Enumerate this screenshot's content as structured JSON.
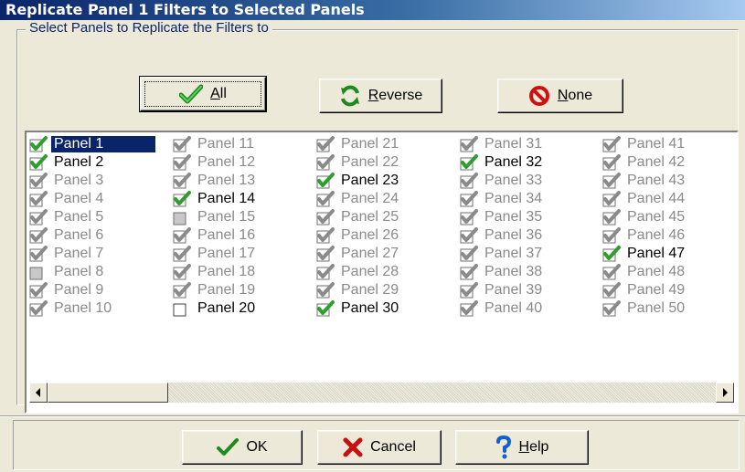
{
  "window": {
    "title": "Replicate Panel 1 Filters to Selected Panels"
  },
  "group": {
    "legend": "Select Panels to Replicate the Filters to"
  },
  "buttons": {
    "all": {
      "mnemonic": "A",
      "rest": "ll",
      "icon": "green-check-icon"
    },
    "reverse": {
      "mnemonic": "R",
      "rest": "everse",
      "icon": "green-refresh-icon"
    },
    "none": {
      "mnemonic": "N",
      "rest": "one",
      "icon": "red-no-sign-icon"
    },
    "ok": {
      "label": "OK",
      "icon": "green-check-icon"
    },
    "cancel": {
      "label": "Cancel",
      "icon": "red-x-icon"
    },
    "help": {
      "mnemonic": "H",
      "rest": "elp",
      "icon": "blue-question-icon"
    }
  },
  "panels": [
    {
      "label": "Panel 1",
      "state": "checked",
      "enabled": true,
      "selected": true
    },
    {
      "label": "Panel 2",
      "state": "checked",
      "enabled": true
    },
    {
      "label": "Panel 3",
      "state": "checked",
      "enabled": false
    },
    {
      "label": "Panel 4",
      "state": "checked",
      "enabled": false
    },
    {
      "label": "Panel 5",
      "state": "checked",
      "enabled": false
    },
    {
      "label": "Panel 6",
      "state": "checked",
      "enabled": false
    },
    {
      "label": "Panel 7",
      "state": "checked",
      "enabled": false
    },
    {
      "label": "Panel 8",
      "state": "grayed",
      "enabled": false
    },
    {
      "label": "Panel 9",
      "state": "checked",
      "enabled": false
    },
    {
      "label": "Panel 10",
      "state": "checked",
      "enabled": false
    },
    {
      "label": "Panel 11",
      "state": "checked",
      "enabled": false
    },
    {
      "label": "Panel 12",
      "state": "checked",
      "enabled": false
    },
    {
      "label": "Panel 13",
      "state": "checked",
      "enabled": false
    },
    {
      "label": "Panel 14",
      "state": "checked",
      "enabled": true
    },
    {
      "label": "Panel 15",
      "state": "grayed",
      "enabled": false
    },
    {
      "label": "Panel 16",
      "state": "checked",
      "enabled": false
    },
    {
      "label": "Panel 17",
      "state": "checked",
      "enabled": false
    },
    {
      "label": "Panel 18",
      "state": "checked",
      "enabled": false
    },
    {
      "label": "Panel 19",
      "state": "checked",
      "enabled": false
    },
    {
      "label": "Panel 20",
      "state": "unchecked",
      "enabled": true
    },
    {
      "label": "Panel 21",
      "state": "checked",
      "enabled": false
    },
    {
      "label": "Panel 22",
      "state": "checked",
      "enabled": false
    },
    {
      "label": "Panel 23",
      "state": "checked",
      "enabled": true
    },
    {
      "label": "Panel 24",
      "state": "checked",
      "enabled": false
    },
    {
      "label": "Panel 25",
      "state": "checked",
      "enabled": false
    },
    {
      "label": "Panel 26",
      "state": "checked",
      "enabled": false
    },
    {
      "label": "Panel 27",
      "state": "checked",
      "enabled": false
    },
    {
      "label": "Panel 28",
      "state": "checked",
      "enabled": false
    },
    {
      "label": "Panel 29",
      "state": "checked",
      "enabled": false
    },
    {
      "label": "Panel 30",
      "state": "checked",
      "enabled": true
    },
    {
      "label": "Panel 31",
      "state": "checked",
      "enabled": false
    },
    {
      "label": "Panel 32",
      "state": "checked",
      "enabled": true
    },
    {
      "label": "Panel 33",
      "state": "checked",
      "enabled": false
    },
    {
      "label": "Panel 34",
      "state": "checked",
      "enabled": false
    },
    {
      "label": "Panel 35",
      "state": "checked",
      "enabled": false
    },
    {
      "label": "Panel 36",
      "state": "checked",
      "enabled": false
    },
    {
      "label": "Panel 37",
      "state": "checked",
      "enabled": false
    },
    {
      "label": "Panel 38",
      "state": "checked",
      "enabled": false
    },
    {
      "label": "Panel 39",
      "state": "checked",
      "enabled": false
    },
    {
      "label": "Panel 40",
      "state": "checked",
      "enabled": false
    },
    {
      "label": "Panel 41",
      "state": "checked",
      "enabled": false
    },
    {
      "label": "Panel 42",
      "state": "checked",
      "enabled": false
    },
    {
      "label": "Panel 43",
      "state": "checked",
      "enabled": false
    },
    {
      "label": "Panel 44",
      "state": "checked",
      "enabled": false
    },
    {
      "label": "Panel 45",
      "state": "checked",
      "enabled": false
    },
    {
      "label": "Panel 46",
      "state": "checked",
      "enabled": false
    },
    {
      "label": "Panel 47",
      "state": "checked",
      "enabled": true
    },
    {
      "label": "Panel 48",
      "state": "checked",
      "enabled": false
    },
    {
      "label": "Panel 49",
      "state": "checked",
      "enabled": false
    },
    {
      "label": "Panel 50",
      "state": "checked",
      "enabled": false
    }
  ],
  "colors": {
    "title_bar": "#0A246A",
    "check_green": "#2E9E2E",
    "disabled_text": "#8A8A8A",
    "selection": "#0A246A"
  }
}
